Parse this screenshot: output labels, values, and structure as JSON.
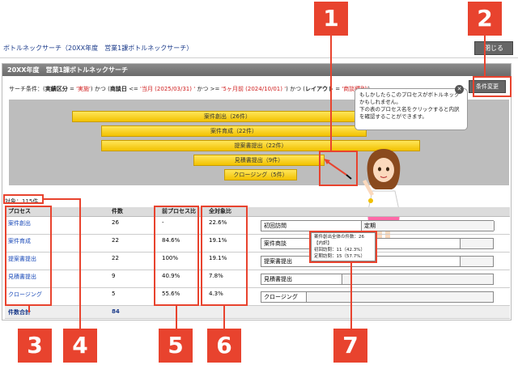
{
  "app": {
    "title": "ボトルネックサーチ（20XX年度　営業1課ボトルネックサーチ）",
    "close_label": "閉じる"
  },
  "panel": {
    "title": "20XX年度　営業1課ボトルネックサーチ",
    "conditions_prefix": "サーチ条件：(",
    "conditions": [
      {
        "key": "実績区分",
        "op": " = ",
        "value": "'実施'",
        "sep": ") かつ ("
      },
      {
        "key": "商談日",
        "op": " <= ",
        "value": "'当月 (2025/03/31) '",
        "sep": " かつ "
      },
      {
        "key": "",
        "op": ">= ",
        "value": "'5ヶ月前 (2024/10/01) '",
        "sep": ") かつ ("
      },
      {
        "key": "レイアウト",
        "op": " = ",
        "value": "'商談種別'",
        "sep": ")"
      }
    ],
    "change_button": "条件変更"
  },
  "funnel": [
    {
      "label": "案件創出（26件）"
    },
    {
      "label": "案件育成（22件）"
    },
    {
      "label": "提案書提出（22件）"
    },
    {
      "label": "見積書提出（9件）"
    },
    {
      "label": "クロージング（5件）"
    }
  ],
  "tooltip": {
    "close": "✕",
    "text": "もしかしたらこのプロセスがボトルネックかもしれません。\n下の表のプロセス名をクリックすると内訳を確認することができます。"
  },
  "count_label": "対象：115件",
  "table": {
    "headers": [
      "プロセス",
      "件数",
      "前プロセス比",
      "全対象比",
      ""
    ],
    "rows": [
      {
        "process": "案件創出",
        "count": "26",
        "prev_ratio": "-",
        "total_ratio": "22.6%",
        "bar_label": "初回訪問",
        "bar_second": "定期"
      },
      {
        "process": "案件育成",
        "count": "22",
        "prev_ratio": "84.6%",
        "total_ratio": "19.1%",
        "bar_label": "案件商談",
        "bar_second": ""
      },
      {
        "process": "提案書提出",
        "count": "22",
        "prev_ratio": "100%",
        "total_ratio": "19.1%",
        "bar_label": "提案書提出",
        "bar_second": ""
      },
      {
        "process": "見積書提出",
        "count": "9",
        "prev_ratio": "40.9%",
        "total_ratio": "7.8%",
        "bar_label": "見積書提出",
        "bar_second": ""
      },
      {
        "process": "クロージング",
        "count": "5",
        "prev_ratio": "55.6%",
        "total_ratio": "4.3%",
        "bar_label": "クロージング",
        "bar_second": ""
      }
    ],
    "total_label": "件数合計",
    "total_value": "84"
  },
  "mini_tip": {
    "line1": "案件創出全体の件数：26",
    "line2": "【内訳】",
    "line3": "初回訪問：11（42.3%）",
    "line4": "定期訪問：15（57.7%）"
  },
  "callouts": [
    "1",
    "2",
    "3",
    "4",
    "5",
    "6",
    "7"
  ],
  "accent_color": "#e8432e"
}
